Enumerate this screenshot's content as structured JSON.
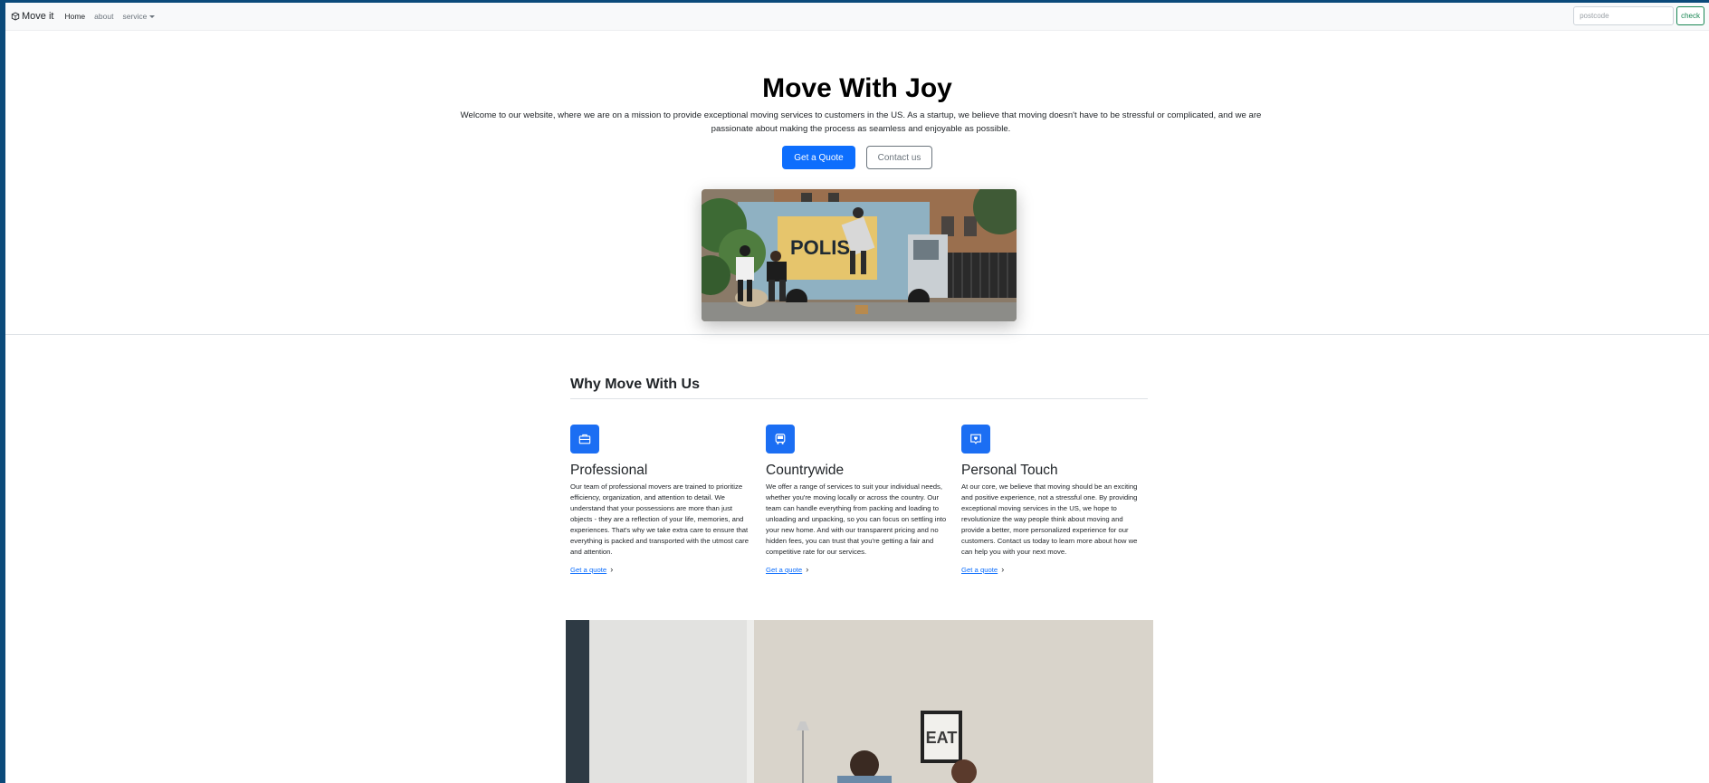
{
  "navbar": {
    "brand": "Move it",
    "links": [
      {
        "label": "Home"
      },
      {
        "label": "about"
      },
      {
        "label": "service"
      }
    ],
    "postcode_placeholder": "postcode",
    "check_label": "check"
  },
  "hero": {
    "title": "Move With Joy",
    "description": "Welcome to our website, where we are on a mission to provide exceptional moving services to customers in the US. As a startup, we believe that moving doesn't have to be stressful or complicated, and we are passionate about making the process as seamless and enjoyable as possible.",
    "primary_button": "Get a Quote",
    "secondary_button": "Contact us",
    "truck_text": "POLIS"
  },
  "why": {
    "title": "Why Move With Us",
    "features": [
      {
        "icon": "briefcase-icon",
        "title": "Professional",
        "text": "Our team of professional movers are trained to prioritize efficiency, organization, and attention to detail. We understand that your possessions are more than just objects - they are a reflection of your life, memories, and experiences. That's why we take extra care to ensure that everything is packed and transported with the utmost care and attention.",
        "link": "Get a quote"
      },
      {
        "icon": "bus-icon",
        "title": "Countrywide",
        "text": "We offer a range of services to suit your individual needs, whether you're moving locally or across the country. Our team can handle everything from packing and loading to unloading and unpacking, so you can focus on settling into your new home. And with our transparent pricing and no hidden fees, you can trust that you're getting a fair and competitive rate for our services.",
        "link": "Get a quote"
      },
      {
        "icon": "heart-chat-icon",
        "title": "Personal Touch",
        "text": "At our core, we believe that moving should be an exciting and positive experience, not a stressful one. By providing exceptional moving services in the US, we hope to revolutionize the way people think about moving and provide a better, more personalized experience for our customers. Contact us today to learn more about how we can help you with your next move.",
        "link": "Get a quote"
      }
    ]
  },
  "bottom_image": {
    "sign_text": "EAT"
  },
  "colors": {
    "primary": "#0d6efd",
    "success": "#198754",
    "icon_bg": "#1b6ef3"
  }
}
